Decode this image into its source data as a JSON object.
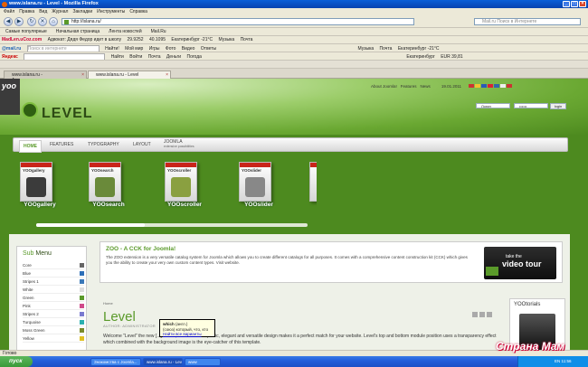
{
  "window": {
    "title": "www.islana.ru - Level - Mozilla Firefox"
  },
  "menubar": [
    "Файл",
    "Правка",
    "Вид",
    "Журнал",
    "Закладки",
    "Инструменты",
    "Справка"
  ],
  "address": {
    "url": "http://islana.ru/",
    "search_placeholder": "Mail.ru Поиск в Интернете"
  },
  "bookmarks": [
    "Самые популярные",
    "Начальная страница",
    "Лента новостей",
    "Mail.Ru"
  ],
  "toolbar1": {
    "site": "MadLen.uCoz.com",
    "items": [
      "Адвокат: Дядя Федор идет в школу",
      "29.9252",
      "40.1095",
      "Екатеринбург -21°C",
      "Музыка",
      "Почта"
    ]
  },
  "toolbar2": {
    "brand": "@mail.ru",
    "search_placeholder": "Поиск в интернете",
    "items": [
      "Найти!",
      "Мой мир",
      "Игры",
      "Фото",
      "Видео",
      "Ответы",
      "Музыка",
      "Почта",
      "Екатеринбург -21°C"
    ]
  },
  "toolbar3": {
    "brand": "Яндекс",
    "items": [
      "Найти",
      "Войти",
      "Почта",
      "Деньги",
      "Погода",
      "Екатеринбург",
      "EUR 39,81"
    ]
  },
  "tabs": [
    {
      "label": "www.islana.ru - Администрирование"
    },
    {
      "label": "www.islana.ru - Level"
    }
  ],
  "site": {
    "corner": "yoo",
    "logo": "LEVEL",
    "toplinks": [
      "About Joomla!",
      "Features",
      "News",
      "19.01.2011"
    ],
    "login_placeholder": "Логин",
    "password_value": "••••••",
    "login_button": "login"
  },
  "nav": [
    {
      "label": "HOME"
    },
    {
      "label": "FEATURES"
    },
    {
      "label": "TYPOGRAPHY"
    },
    {
      "label": "LAYOUT"
    },
    {
      "label": "JOOMLA",
      "sub": "extensive possibilities"
    }
  ],
  "products": [
    {
      "name": "YOOgallery",
      "box": "YOOgallery",
      "color": "#3b3b3b"
    },
    {
      "name": "YOOsearch",
      "box": "YOOsearch",
      "color": "#6a8a3a"
    },
    {
      "name": "YOOscroller",
      "box": "YOOscroller",
      "color": "#8aa040"
    },
    {
      "name": "YOOslider",
      "box": "YOOslider",
      "color": "#888888"
    }
  ],
  "submenu": {
    "title_a": "Sub",
    "title_b": "Menu",
    "items": [
      {
        "label": "Core",
        "color": "#666666"
      },
      {
        "label": "Blue",
        "color": "#2d6fb8"
      },
      {
        "label": "Stripes 1",
        "color": "#3a78b8"
      },
      {
        "label": "White",
        "color": "#dddddd"
      },
      {
        "label": "Green",
        "color": "#5a9a2a"
      },
      {
        "label": "Pink",
        "color": "#d04a8a"
      },
      {
        "label": "Stripes 2",
        "color": "#7a7ad0"
      },
      {
        "label": "Turquoise",
        "color": "#2ab0b0"
      },
      {
        "label": "Moss Green",
        "color": "#7a8a2a"
      },
      {
        "label": "Yellow",
        "color": "#e0c020"
      }
    ]
  },
  "zoo": {
    "title": "ZOO - A CCK for Joomla!",
    "text": "The ZOO extension is a very versatile catalog system for Joomla which allows you to create different catalogs for all purposes. It comes with a comprehensive content construction kit (CCK) which gives you the ability to create your very own custom content types. Visit website."
  },
  "video": {
    "line1": "take the",
    "line2": "video tour"
  },
  "article": {
    "crumb": "Home",
    "title": "Level",
    "author": "AUTHOR: ADMINISTRATOR",
    "text": "Welcome \"Level\" the new [...] theme, the overall simplistic, elegant and versatile design makes it a perfect match for your website. Level's top and bottom module position uses a transparency effect which combined with the background image is the eye-catcher of this template."
  },
  "tooltip": {
    "word": "which",
    "trans": "(англ.)",
    "line2": "(союз) который, что, кто",
    "link": "Найти все варианты"
  },
  "yootorials": {
    "title": "YOOtorials"
  },
  "status": {
    "text": "Готово"
  },
  "taskbar": {
    "start": "пуск",
    "items": [
      {
        "label": "Знакомства с Joomla..."
      },
      {
        "label": "www.islana.ru - Level..."
      },
      {
        "label": "www"
      }
    ],
    "lang": "EN",
    "clock": "11:56"
  },
  "watermark": "Страна Мам"
}
